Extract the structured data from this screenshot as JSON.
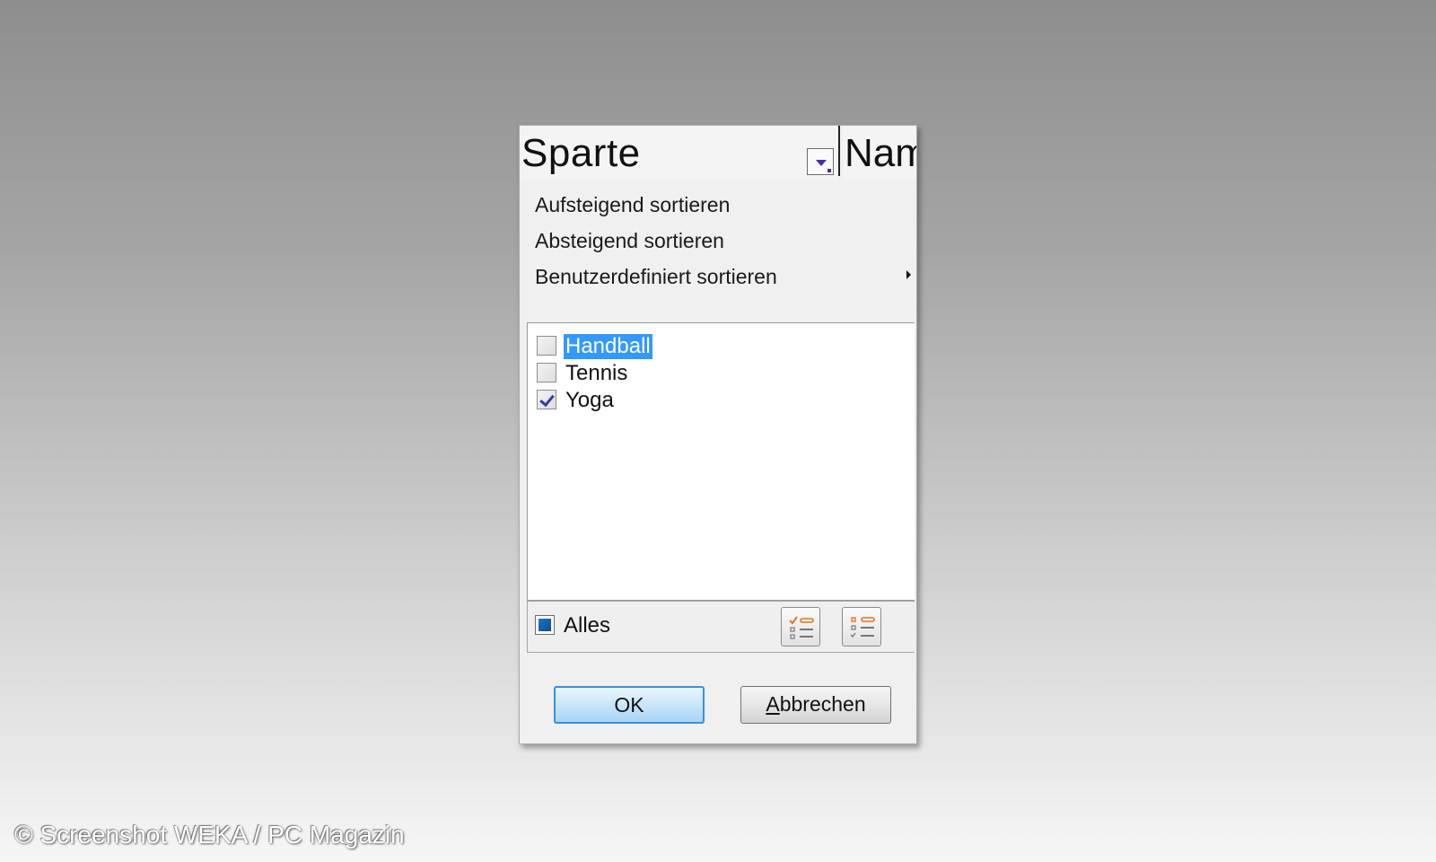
{
  "header": {
    "column_title": "Sparte",
    "next_column_title_partial": "Nam",
    "filter_icon": "dropdown-arrow-icon"
  },
  "menu": {
    "items": [
      {
        "label": "Aufsteigend sortieren"
      },
      {
        "label": "Absteigend sortieren"
      },
      {
        "label": "Benutzerdefiniert sortieren",
        "has_submenu": true
      }
    ]
  },
  "filter_list": {
    "items": [
      {
        "label": "Handball",
        "checked": false,
        "selected": true
      },
      {
        "label": "Tennis",
        "checked": false,
        "selected": false
      },
      {
        "label": "Yoga",
        "checked": true,
        "selected": false
      }
    ]
  },
  "bottom_bar": {
    "all_label": "Alles",
    "all_state": "indeterminate",
    "icons": [
      "select-all-list-icon",
      "deselect-all-list-icon"
    ]
  },
  "buttons": {
    "ok_label": "OK",
    "cancel_label_mnemonic": "A",
    "cancel_label_rest": "bbrechen"
  },
  "footer": {
    "copyright": "© Screenshot WEKA / PC Magazin"
  },
  "colors": {
    "selection": "#3399ff",
    "check": "#2b3fa8",
    "ok_border": "#3c8fd6"
  }
}
